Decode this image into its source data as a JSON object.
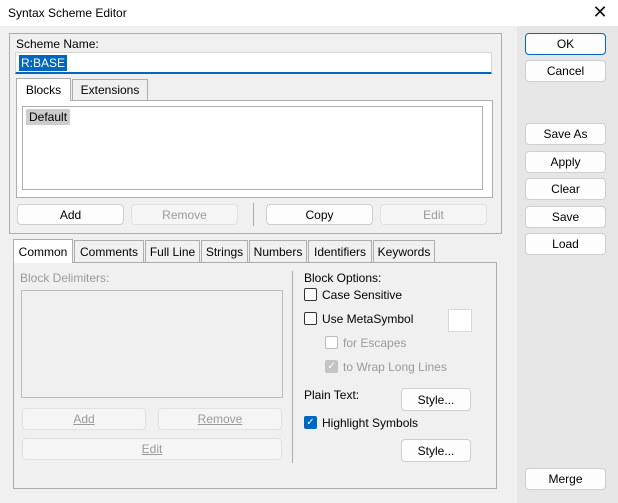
{
  "window": {
    "title": "Syntax Scheme Editor"
  },
  "scheme": {
    "label": "Scheme Name:",
    "value": "R:BASE"
  },
  "top_tabs": [
    "Blocks",
    "Extensions"
  ],
  "blocks_list": [
    "Default"
  ],
  "block_buttons": {
    "add": "Add",
    "remove": "Remove",
    "copy": "Copy",
    "edit": "Edit"
  },
  "bottom_tabs": [
    "Common",
    "Comments",
    "Full Line",
    "Strings",
    "Numbers",
    "Identifiers",
    "Keywords"
  ],
  "delimiters": {
    "label": "Block Delimiters:",
    "add": "Add",
    "remove": "Remove",
    "edit": "Edit"
  },
  "block_options": {
    "label": "Block Options:",
    "case_sensitive": "Case Sensitive",
    "use_metasymbol": "Use MetaSymbol",
    "for_escapes": "for Escapes",
    "to_wrap": "to Wrap Long Lines",
    "plain_text": "Plain Text:",
    "style1": "Style...",
    "highlight_symbols": "Highlight Symbols",
    "style2": "Style..."
  },
  "side_buttons": {
    "ok": "OK",
    "cancel": "Cancel",
    "save_as": "Save As",
    "apply": "Apply",
    "clear": "Clear",
    "save": "Save",
    "load": "Load",
    "merge": "Merge"
  },
  "icons": {
    "close": "close-icon",
    "check": "check-icon"
  },
  "colors": {
    "accent": "#0067c0",
    "selection": "#cccccc"
  }
}
